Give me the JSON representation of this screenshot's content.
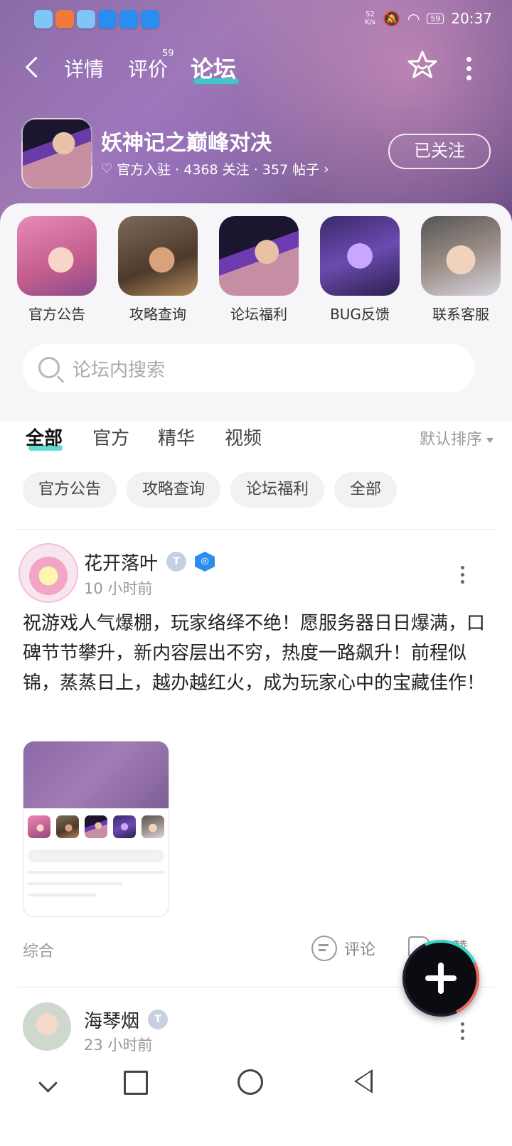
{
  "status": {
    "time": "20:37",
    "battery": "59",
    "net_speed": "52\nK/s"
  },
  "header": {
    "tabs": {
      "detail": "详情",
      "review": "评价",
      "review_count": "59",
      "forum": "论坛"
    }
  },
  "game": {
    "title": "妖神记之巅峰对决",
    "meta": "官方入驻 · 4368 关注 · 357 帖子",
    "follow_label": "已关注"
  },
  "shortcuts": [
    {
      "label": "官方公告"
    },
    {
      "label": "攻略查询"
    },
    {
      "label": "论坛福利"
    },
    {
      "label": "BUG反馈"
    },
    {
      "label": "联系客服"
    }
  ],
  "search": {
    "placeholder": "论坛内搜索"
  },
  "filters": {
    "tabs": [
      "全部",
      "官方",
      "精华",
      "视频"
    ],
    "sort": "默认排序"
  },
  "chips": [
    "官方公告",
    "攻略查询",
    "论坛福利",
    "全部"
  ],
  "posts": [
    {
      "author": "花开落叶",
      "time": "10 小时前",
      "text": "祝游戏人气爆棚，玩家络绎不绝！愿服务器日日爆满，口碑节节攀升，新内容层出不穷，热度一路飙升！前程似锦，蒸蒸日上，越办越红火，成为玩家心中的宝藏佳作！",
      "category": "综合",
      "comment_label": "评论",
      "like_label": "点赞"
    },
    {
      "author": "海琴烟",
      "time": "23 小时前"
    }
  ],
  "colors": {
    "accent": "#33d3c9",
    "header_bg": "#8b6aa8"
  }
}
